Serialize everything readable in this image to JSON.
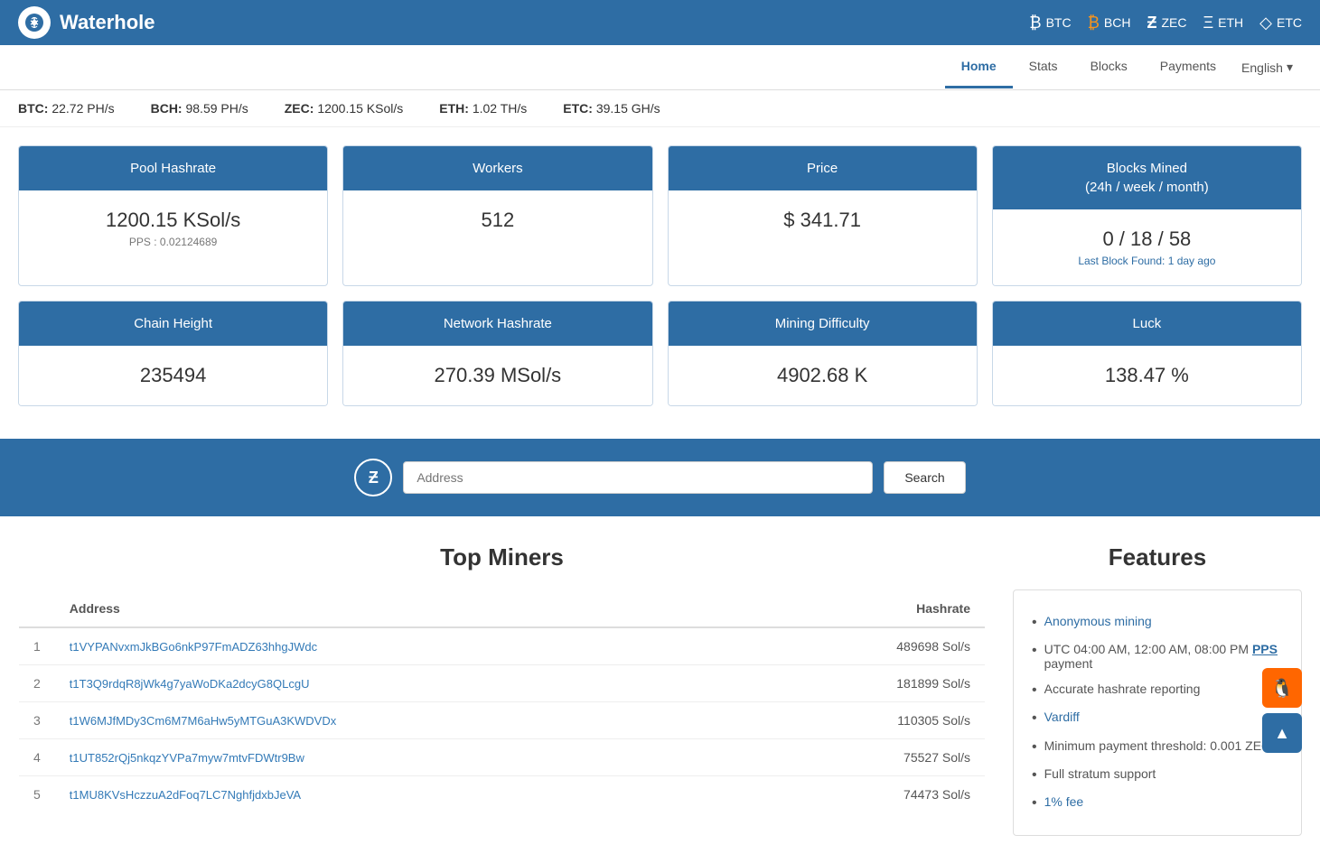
{
  "header": {
    "logo_text": "Waterhole",
    "coins": [
      {
        "label": "BTC",
        "icon": "₿"
      },
      {
        "label": "BCH",
        "icon": "₿"
      },
      {
        "label": "ZEC",
        "icon": "Ƶ"
      },
      {
        "label": "ETH",
        "icon": "Ξ"
      },
      {
        "label": "ETC",
        "icon": "◇"
      }
    ]
  },
  "nav": {
    "links": [
      "Home",
      "Stats",
      "Blocks",
      "Payments"
    ],
    "active": "Home",
    "language": "English"
  },
  "hashrates": [
    {
      "coin": "BTC:",
      "value": "22.72 PH/s"
    },
    {
      "coin": "BCH:",
      "value": "98.59 PH/s"
    },
    {
      "coin": "ZEC:",
      "value": "1200.15 KSol/s"
    },
    {
      "coin": "ETH:",
      "value": "1.02 TH/s"
    },
    {
      "coin": "ETC:",
      "value": "39.15 GH/s"
    }
  ],
  "stats": {
    "row1": [
      {
        "header": "Pool Hashrate",
        "value": "1200.15 KSol/s",
        "sub": "PPS : 0.02124689"
      },
      {
        "header": "Workers",
        "value": "512",
        "sub": ""
      },
      {
        "header": "Price",
        "value": "$ 341.71",
        "sub": ""
      },
      {
        "header": "Blocks Mined\n(24h / week / month)",
        "value": "0 / 18 / 58",
        "sub": "Last Block Found: 1 day ago"
      }
    ],
    "row2": [
      {
        "header": "Chain Height",
        "value": "235494",
        "sub": ""
      },
      {
        "header": "Network Hashrate",
        "value": "270.39 MSol/s",
        "sub": ""
      },
      {
        "header": "Mining Difficulty",
        "value": "4902.68 K",
        "sub": ""
      },
      {
        "header": "Luck",
        "value": "138.47 %",
        "sub": ""
      }
    ]
  },
  "search": {
    "placeholder": "Address",
    "button_label": "Search",
    "zec_symbol": "Ƶ"
  },
  "top_miners": {
    "title": "Top Miners",
    "columns": [
      "",
      "Address",
      "Hashrate"
    ],
    "rows": [
      {
        "rank": "1",
        "address": "t1VYPANvxmJkBGo6nkP97FmADZ63hhgJWdc",
        "hashrate": "489698 Sol/s"
      },
      {
        "rank": "2",
        "address": "t1T3Q9rdqR8jWk4g7yaWoDKa2dcyG8QLcgU",
        "hashrate": "181899 Sol/s"
      },
      {
        "rank": "3",
        "address": "t1W6MJfMDy3Cm6M7M6aHw5yMTGuA3KWDVDx",
        "hashrate": "110305 Sol/s"
      },
      {
        "rank": "4",
        "address": "t1UT852rQj5nkqzYVPa7myw7mtvFDWtr9Bw",
        "hashrate": "75527 Sol/s"
      },
      {
        "rank": "5",
        "address": "t1MU8KVsHczzuA2dFoq7LC7NghfjdxbJeVA",
        "hashrate": "74473 Sol/s"
      }
    ]
  },
  "features": {
    "title": "Features",
    "items": [
      {
        "text": "Anonymous mining",
        "link": true,
        "link_text": "Anonymous mining"
      },
      {
        "text": "UTC 04:00 AM, 12:00 AM, 08:00 PM PPS payment",
        "has_pps": true
      },
      {
        "text": "Accurate hashrate reporting"
      },
      {
        "text": "Vardiff",
        "link": true,
        "link_text": "Vardiff"
      },
      {
        "text": "Minimum payment threshold: 0.001 ZEC"
      },
      {
        "text": "Full stratum support"
      },
      {
        "text": "1% fee",
        "link": true,
        "link_text": "1% fee"
      }
    ]
  }
}
